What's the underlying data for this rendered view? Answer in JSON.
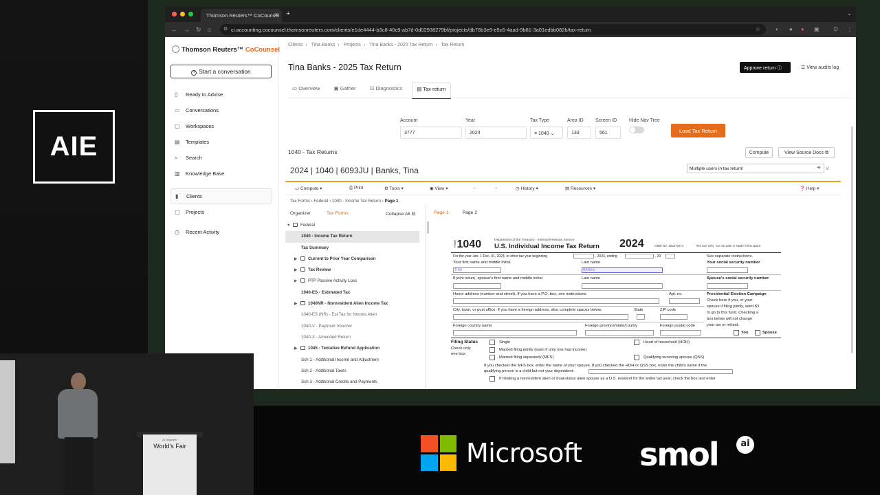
{
  "overlay": {
    "event_logo": "AIE",
    "podium_small": "AI Engineer",
    "podium_label": "World's Fair",
    "sponsor_microsoft": "Microsoft",
    "sponsor_smol": "smol",
    "sponsor_smol_badge": "ai"
  },
  "browser": {
    "tab_title": "Thomson Reuters™ CoCounsel",
    "url": "ci.accounting.cocounsel.thomsonreuters.com/clients/e1de4444-b3c8-40c9-ab7d-0d02938279bf/projects/db76b3e9-e5c6-4aad-9b81-3a01edbb082b/tax-return"
  },
  "sidebar": {
    "brand_name": "Thomson Reuters",
    "brand_product": "CoCounsel",
    "start_button": "Start a conversation",
    "items": [
      {
        "label": "Ready to Advise"
      },
      {
        "label": "Conversations"
      },
      {
        "label": "Workspaces"
      },
      {
        "label": "Templates"
      },
      {
        "label": "Search"
      },
      {
        "label": "Knowledge Base"
      },
      {
        "label": "Clients"
      },
      {
        "label": "Projects"
      },
      {
        "label": "Recent Activity"
      }
    ]
  },
  "main": {
    "breadcrumb": [
      "Clients",
      "Tina Banks",
      "Projects",
      "Tina Banks - 2025 Tax Return",
      "Tax Return"
    ],
    "title": "Tina Banks - 2025 Tax Return",
    "approve_button": "Approve return",
    "audit_link": "View audits log",
    "tabs": [
      {
        "label": "Overview"
      },
      {
        "label": "Gather"
      },
      {
        "label": "Diagnostics"
      },
      {
        "label": "Tax return"
      }
    ],
    "fields": {
      "account_label": "Account",
      "account_value": "3777",
      "year_label": "Year",
      "year_value": "2024",
      "taxtype_label": "Tax Type",
      "taxtype_value": "1040",
      "areaid_label": "Area ID",
      "areaid_value": "133",
      "screenid_label": "Screen ID",
      "screenid_value": "561",
      "hidenav_label": "Hide Nav Tree"
    },
    "load_button": "Load Tax Return",
    "section_title": "1040 - Tax Returns",
    "compute_button": "Compute",
    "source_docs_button": "View Source Docs",
    "return_header": "2024 | 1040 | 6093JU | Banks, Tina",
    "toast": "Multiple users in tax return!"
  },
  "toolbar": {
    "compute": "Compute",
    "print": "Print",
    "tools": "Tools",
    "view": "View",
    "history": "History",
    "resources": "Resources",
    "help": "Help"
  },
  "form_breadcrumb": [
    "Tax Forms",
    "Federal",
    "1040 - Income Tax Return",
    "Page 1"
  ],
  "tree": {
    "organizer": "Organizer",
    "tax_forms": "Tax Forms",
    "collapse_all": "Collapse All",
    "rows": [
      {
        "label": "Federal"
      },
      {
        "label": "1040 - Income Tax Return"
      },
      {
        "label": "Tax Summary"
      },
      {
        "label": "Current to Prior Year Comparison"
      },
      {
        "label": "Tax Review"
      },
      {
        "label": "PTP Passive Activity Loss"
      },
      {
        "label": "1040-ES - Estimated Tax"
      },
      {
        "label": "1040NR - Nonresident Alien Income Tax"
      },
      {
        "label": "1040-ES (NR) - Est Tax for Nonres Alien"
      },
      {
        "label": "1040-V - Payment Voucher"
      },
      {
        "label": "1040-X - Amended Return"
      },
      {
        "label": "1045 - Tentative Refund Application"
      },
      {
        "label": "Sch 1 - Additional Income and Adjustmen"
      },
      {
        "label": "Sch 2 - Additional Taxes"
      },
      {
        "label": "Sch 3 - Additional Credits and Payments"
      }
    ]
  },
  "pages": {
    "page1": "Page 1",
    "page2": "Page 2"
  },
  "form": {
    "form_number": "1040",
    "form_word": "Form",
    "dept": "Department of the Treasury - Internal Revenue Service",
    "title": "U.S. Individual Income Tax Return",
    "year": "2024",
    "omb": "OMB No. 1545-0074",
    "irs_only": "IRS Use Only - Do not write or staple in this space.",
    "for_year": "For the year Jan. 1-Dec. 31, 2024, or other tax year beginning",
    "ending": ", 2024, ending",
    "ending_year": ", 20",
    "see_separate": "See separate instructions.",
    "first_name_label": "Your first name and middle initial",
    "first_name_value": "TINA",
    "last_name_label": "Last name",
    "last_name_value": "BANKS",
    "ssn_label": "Your social security number",
    "spouse_first_label": "If joint return, spouse's first name and middle initial",
    "spouse_last_label": "Last name",
    "spouse_ssn_label": "Spouse's social security number",
    "address_label": "Home address (number and street). If you have a P.O. box, see instructions.",
    "apt_label": "Apt. no.",
    "pec_label": "Presidential Election Campaign",
    "pec_text_1": "Check here if you, or your",
    "pec_text_2": "spouse if filing jointly, want $3",
    "pec_text_3": "to go to this fund. Checking a",
    "pec_text_4": "box below will not change",
    "pec_text_5": "your tax or refund.",
    "pec_you": "You",
    "pec_spouse": "Spouse",
    "city_label": "City, town, or post office. If you have a foreign address, also complete spaces below.",
    "state_label": "State",
    "zip_label": "ZIP code",
    "foreign_country_label": "Foreign country name",
    "foreign_province_label": "Foreign province/state/county",
    "foreign_postal_label": "Foreign postal code",
    "filing_status_label": "Filing Status",
    "check_only": "Check only",
    "one_box": "one box.",
    "fs_single": "Single",
    "fs_mfj": "Married filing jointly (even if only one had income)",
    "fs_mfs": "Married filing separately (MFS)",
    "fs_hoh": "Head of household (HOH)",
    "fs_qss": "Qualifying surviving spouse (QSS)",
    "mfs_note_1": "If you checked the MFS box, enter the name of your spouse. If you checked the HOH or QSS box, enter the child's name if the",
    "mfs_note_2": "qualifying person is a child but not your dependent:",
    "nonres_note": "If treating a nonresident alien or dual-status alien spouse as a U.S. resident for the entire tax year, check the box and enter"
  }
}
